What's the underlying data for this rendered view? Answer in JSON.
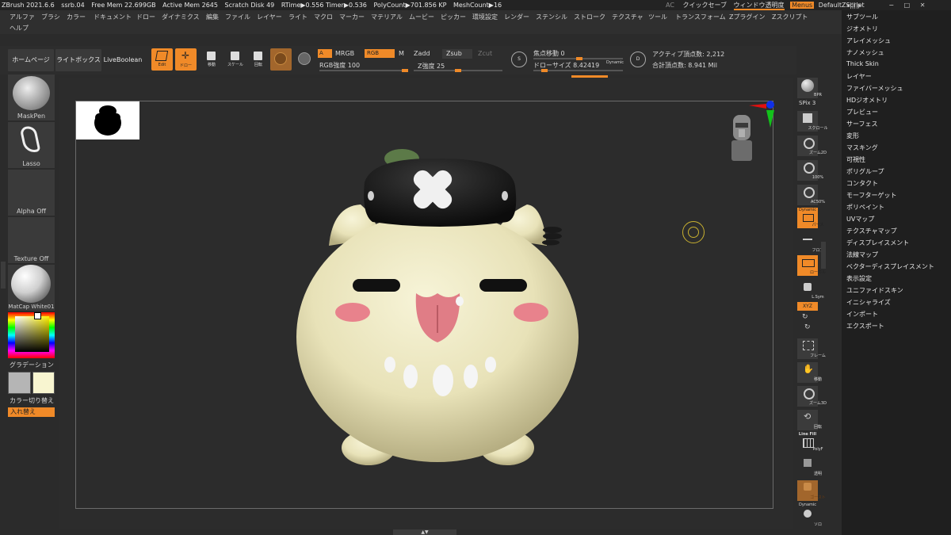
{
  "titlebar": {
    "app": "ZBrush 2021.6.6",
    "project": "ssrb.04",
    "free_mem": "Free Mem 22.699GB",
    "active_mem": "Active Mem 2645",
    "scratch": "Scratch Disk 49",
    "rtime": "RTime▶0.556 Timer▶0.536",
    "polycount": "PolyCount▶701.856 KP",
    "meshcount": "MeshCount▶16",
    "ac": "AC",
    "quicksave": "クイックセーブ",
    "transparency": "ウィンドウ透明度",
    "menus": "Menus",
    "script": "DefaultZScript"
  },
  "menubar": [
    "アルファ",
    "ブラシ",
    "カラー",
    "ドキュメント",
    "ドロー",
    "ダイナミクス",
    "編集",
    "ファイル",
    "レイヤー",
    "ライト",
    "マクロ",
    "マーカー",
    "マテリアル",
    "ムービー",
    "ピッカー",
    "環境設定",
    "レンダー",
    "ステンシル",
    "ストローク",
    "テクスチャ",
    "ツール",
    "トランスフォーム",
    "Zプラグイン",
    "Zスクリプト",
    "ヘルプ"
  ],
  "toolbar": {
    "home": "ホームページ",
    "lightbox": "ライトボックス",
    "liveboolean": "LiveBoolean",
    "edit": "Edit",
    "draw": "ドロー",
    "move": "移動",
    "scale": "スケール",
    "rotate": "回転",
    "a_label": "A",
    "mrgb": "MRGB",
    "rgb": "RGB",
    "m": "M",
    "rgb_intensity": "RGB強度 100",
    "zadd": "Zadd",
    "zsub": "Zsub",
    "zcut": "Zcut",
    "z_intensity": "Z強度 25",
    "focal_shift": "焦点移動 0",
    "draw_size": "ドローサイズ 8.42419",
    "dynamic": "Dynamic",
    "active_points": "アクティブ頂点数: 2,212",
    "total_points": "合計頂点数: 8.941 Mil"
  },
  "leftshelf": {
    "brush": "MaskPen",
    "stroke": "Lasso",
    "alpha": "Alpha Off",
    "texture": "Texture Off",
    "material": "MatCap White01",
    "gradient": "グラデーション",
    "switch_color": "カラー切り替え",
    "swap": "入れ替え"
  },
  "rightshelf": {
    "bpr": "BPR",
    "spix": "SPix 3",
    "scroll": "スクロール",
    "zoom2d": "ズーム2D",
    "pct100": "100%",
    "ac50": "AC50%",
    "dynamic_persp": "Dynamic",
    "persp": "パース",
    "floor": "フロア",
    "local": "ローカル",
    "lsym": "L.Sym",
    "xyz": "XYZ",
    "frame": "フレーム",
    "move": "移動",
    "zoom3d": "ズーム3D",
    "rotate": "回転",
    "linefill": "Line Fill",
    "polyf": "PolyF",
    "transp": "透明",
    "ghost": "ゴースト",
    "dynamic2": "Dynamic",
    "solo": "ソロ"
  },
  "rightmenu": [
    "サブツール",
    "ジオメトリ",
    "アレイメッシュ",
    "ナノメッシュ",
    "Thick Skin",
    "レイヤー",
    "ファイバーメッシュ",
    "HDジオメトリ",
    "プレビュー",
    "サーフェス",
    "変形",
    "マスキング",
    "可視性",
    "ポリグループ",
    "コンタクト",
    "モーフターゲット",
    "ポリペイント",
    "UVマップ",
    "テクスチャマップ",
    "ディスプレイスメント",
    "法線マップ",
    "ベクターディスプレイスメント",
    "表示設定",
    "ユニファイドスキン",
    "イニシャライズ",
    "インポート",
    "エクスポート"
  ],
  "colors": {
    "accent": "#f08a28",
    "panel": "#2d2d2d",
    "body": "#ede8c4",
    "hat": "#151515",
    "cheek": "#e8828c",
    "tongue": "#e07d86"
  }
}
